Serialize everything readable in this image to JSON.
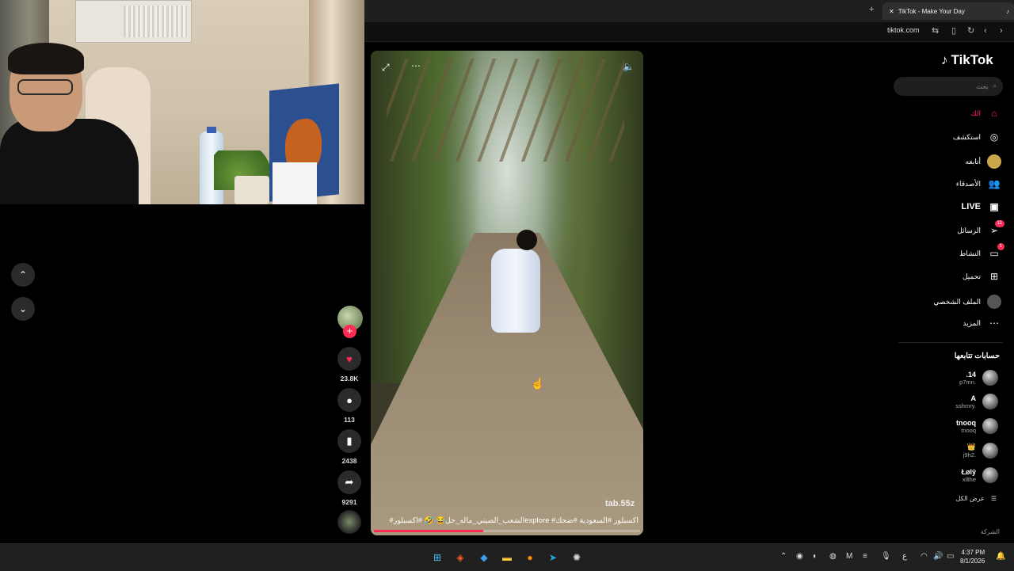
{
  "browser": {
    "tab_title": "TikTok - Make Your Day",
    "url": "tiktok.com",
    "new_tab_label": "+",
    "close_label": "✕"
  },
  "video": {
    "watermark": "tab.55z",
    "caption": "#الشعب_الصيني_ماله_حل😂 🤣 #اكسبلورexplore #اكسبلور #السعودية #ضحك",
    "progress": 0.41
  },
  "actions": {
    "likes": "23.8K",
    "comments": "113",
    "saves": "2438",
    "shares": "9291"
  },
  "sidebar": {
    "logo": "TikTok",
    "search_placeholder": "بحث",
    "nav": [
      {
        "label": "الك",
        "icon": "home-icon"
      },
      {
        "label": "استكشف",
        "icon": "compass-icon"
      },
      {
        "label": "أتابعه",
        "icon": "following-icon"
      },
      {
        "label": "الأصدقاء",
        "icon": "friends-icon"
      },
      {
        "label": "LIVE",
        "icon": "live-icon"
      },
      {
        "label": "الرسائل",
        "icon": "messages-icon",
        "badge": "11"
      },
      {
        "label": "النشاط",
        "icon": "activity-icon",
        "badge": "1"
      },
      {
        "label": "تحميل",
        "icon": "upload-icon"
      },
      {
        "label": "الملف الشخصي",
        "icon": "profile-icon"
      },
      {
        "label": "المزيد",
        "icon": "more-icon"
      }
    ],
    "following_title": "حسابات تتابعها",
    "accounts": [
      {
        "name": ".14",
        "handle": "p7mn."
      },
      {
        "name": "A",
        "handle": "sshmry."
      },
      {
        "name": "tnooq",
        "handle": "tnooq"
      },
      {
        "name": "👑",
        "handle": "j9h2."
      },
      {
        "name": "Łølÿ",
        "handle": "xlllhe"
      }
    ],
    "see_all": "عرض الكل",
    "company": "الشركة"
  },
  "taskbar": {
    "time": "4:37 PM",
    "date": "8/1/2026",
    "lang": "ع"
  }
}
